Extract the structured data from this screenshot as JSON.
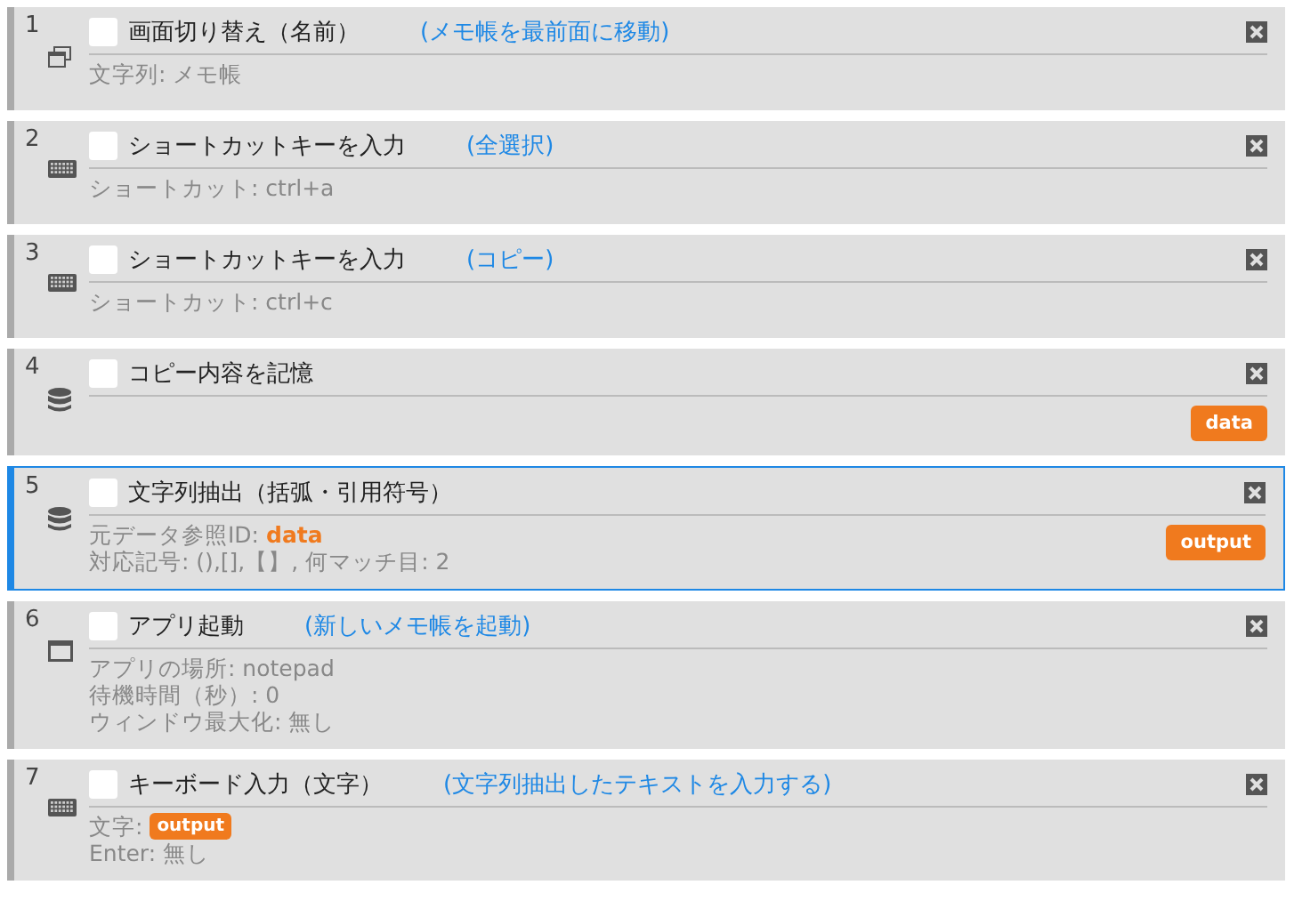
{
  "steps": [
    {
      "number": "1",
      "kind": "switch",
      "title": "画面切り替え（名前）",
      "comment": "(メモ帳を最前面に移動)",
      "checked": false,
      "selected": false,
      "lines": [
        [
          {
            "kind": "text",
            "text": "文字列: メモ帳"
          }
        ]
      ]
    },
    {
      "number": "2",
      "kind": "shortcut",
      "title": "ショートカットキーを入力",
      "comment": "(全選択)",
      "checked": false,
      "selected": false,
      "lines": [
        [
          {
            "kind": "text",
            "text": "ショートカット: ctrl+a"
          }
        ]
      ]
    },
    {
      "number": "3",
      "kind": "shortcut",
      "title": "ショートカットキーを入力",
      "comment": "(コピー)",
      "checked": false,
      "selected": false,
      "lines": [
        [
          {
            "kind": "text",
            "text": "ショートカット: ctrl+c"
          }
        ]
      ]
    },
    {
      "number": "4",
      "kind": "store",
      "title": "コピー内容を記憶",
      "checked": false,
      "selected": false,
      "output_tag": "data"
    },
    {
      "number": "5",
      "kind": "extract",
      "title": "文字列抽出（括弧・引用符号）",
      "checked": false,
      "selected": true,
      "lines": [
        [
          {
            "kind": "text",
            "text": "元データ参照ID: "
          },
          {
            "kind": "ref",
            "text": "data"
          }
        ],
        [
          {
            "kind": "text",
            "text": "対応記号: (),[],【】, 何マッチ目: 2"
          }
        ]
      ],
      "output_tag": "output"
    },
    {
      "number": "6",
      "kind": "launch",
      "title": "アプリ起動",
      "comment": "(新しいメモ帳を起動)",
      "checked": false,
      "selected": false,
      "lines": [
        [
          {
            "kind": "text",
            "text": "アプリの場所: notepad"
          }
        ],
        [
          {
            "kind": "text",
            "text": "待機時間（秒）: 0"
          }
        ],
        [
          {
            "kind": "text",
            "text": "ウィンドウ最大化: 無し"
          }
        ]
      ]
    },
    {
      "number": "7",
      "kind": "typing",
      "title": "キーボード入力（文字）",
      "comment": "(文字列抽出したテキストを入力する)",
      "checked": false,
      "selected": false,
      "lines": [
        [
          {
            "kind": "text",
            "text": "文字: "
          },
          {
            "kind": "badge",
            "text": "output"
          }
        ],
        [
          {
            "kind": "text",
            "text": "Enter: 無し"
          }
        ]
      ]
    }
  ]
}
